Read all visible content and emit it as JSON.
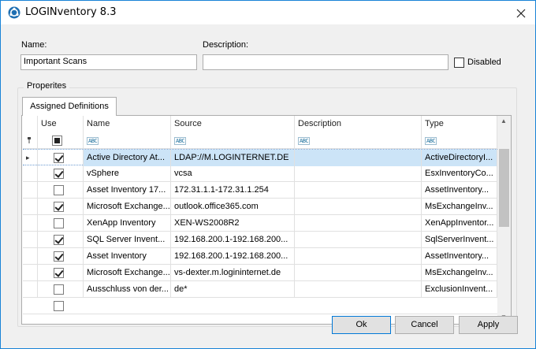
{
  "window": {
    "title": "LOGINventory 8.3"
  },
  "form": {
    "name_label": "Name:",
    "name_value": "Important Scans",
    "description_label": "Description:",
    "description_value": "",
    "disabled_label": "Disabled"
  },
  "properties": {
    "group_label": "Properites",
    "tab_label": "Assigned Definitions"
  },
  "grid": {
    "headers": {
      "use": "Use",
      "name": "Name",
      "source": "Source",
      "description": "Description",
      "type": "Type"
    },
    "filter_icon": "ABC",
    "rows": [
      {
        "use": true,
        "name": "Active Directory At...",
        "source": "LDAP://M.LOGINTERNET.DE",
        "description": "",
        "type": "ActiveDirectoryI..."
      },
      {
        "use": true,
        "name": "vSphere",
        "source": "vcsa",
        "description": "",
        "type": "EsxInventoryCo..."
      },
      {
        "use": false,
        "name": "Asset Inventory 17...",
        "source": "172.31.1.1-172.31.1.254",
        "description": "",
        "type": "AssetInventory..."
      },
      {
        "use": true,
        "name": "Microsoft Exchange...",
        "source": "outlook.office365.com",
        "description": "",
        "type": "MsExchangeInv..."
      },
      {
        "use": false,
        "name": "XenApp Inventory",
        "source": "XEN-WS2008R2",
        "description": "",
        "type": "XenAppInventor..."
      },
      {
        "use": true,
        "name": "SQL Server Invent...",
        "source": "192.168.200.1-192.168.200...",
        "description": "",
        "type": "SqlServerInvent..."
      },
      {
        "use": true,
        "name": "Asset Inventory",
        "source": "192.168.200.1-192.168.200...",
        "description": "",
        "type": "AssetInventory..."
      },
      {
        "use": true,
        "name": "Microsoft Exchange...",
        "source": "vs-dexter.m.logininternet.de",
        "description": "",
        "type": "MsExchangeInv..."
      },
      {
        "use": false,
        "name": "Ausschluss von der...",
        "source": "de*",
        "description": "",
        "type": "ExclusionInvent..."
      }
    ]
  },
  "buttons": {
    "ok": "Ok",
    "cancel": "Cancel",
    "apply": "Apply"
  }
}
